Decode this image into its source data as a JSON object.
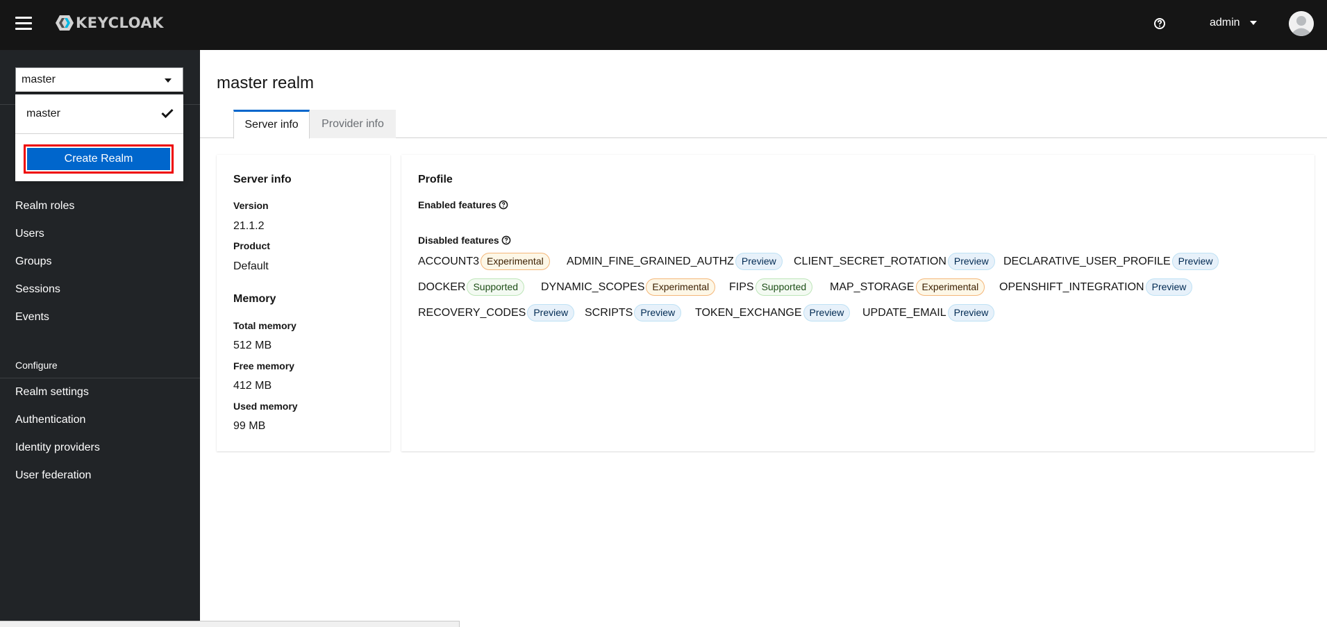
{
  "header": {
    "logo_text": "KEYCLOAK",
    "user_name": "admin"
  },
  "sidebar": {
    "realm_selected": "master",
    "items": [
      {
        "label": "Realm roles"
      },
      {
        "label": "Users"
      },
      {
        "label": "Groups"
      },
      {
        "label": "Sessions"
      },
      {
        "label": "Events"
      }
    ],
    "configure_heading": "Configure",
    "configure_items": [
      {
        "label": "Realm settings"
      },
      {
        "label": "Authentication"
      },
      {
        "label": "Identity providers"
      },
      {
        "label": "User federation"
      }
    ]
  },
  "realm_dropdown": {
    "option": "master",
    "create_label": "Create Realm"
  },
  "main": {
    "title": "master realm",
    "tabs": [
      {
        "label": "Server info"
      },
      {
        "label": "Provider info"
      }
    ],
    "server_info": {
      "title": "Server info",
      "version_label": "Version",
      "version_value": "21.1.2",
      "product_label": "Product",
      "product_value": "Default",
      "memory_title": "Memory",
      "total_label": "Total memory",
      "total_value": "512 MB",
      "free_label": "Free memory",
      "free_value": "412 MB",
      "used_label": "Used memory",
      "used_value": "99 MB"
    },
    "profile": {
      "title": "Profile",
      "enabled_label": "Enabled features",
      "disabled_label": "Disabled features",
      "features": [
        {
          "name": "ACCOUNT3",
          "badge": "Experimental"
        },
        {
          "name": "ADMIN_FINE_GRAINED_AUTHZ",
          "badge": "Preview"
        },
        {
          "name": "CLIENT_SECRET_ROTATION",
          "badge": "Preview"
        },
        {
          "name": "DECLARATIVE_USER_PROFILE",
          "badge": "Preview"
        },
        {
          "name": "DOCKER",
          "badge": "Supported"
        },
        {
          "name": "DYNAMIC_SCOPES",
          "badge": "Experimental"
        },
        {
          "name": "FIPS",
          "badge": "Supported"
        },
        {
          "name": "MAP_STORAGE",
          "badge": "Experimental"
        },
        {
          "name": "OPENSHIFT_INTEGRATION",
          "badge": "Preview"
        },
        {
          "name": "RECOVERY_CODES",
          "badge": "Preview"
        },
        {
          "name": "SCRIPTS",
          "badge": "Preview"
        },
        {
          "name": "TOKEN_EXCHANGE",
          "badge": "Preview"
        },
        {
          "name": "UPDATE_EMAIL",
          "badge": "Preview"
        }
      ]
    }
  },
  "colors": {
    "masthead": "#151515",
    "sidebar": "#212427",
    "primary": "#0066cc",
    "highlight_border": "#ee0000"
  }
}
